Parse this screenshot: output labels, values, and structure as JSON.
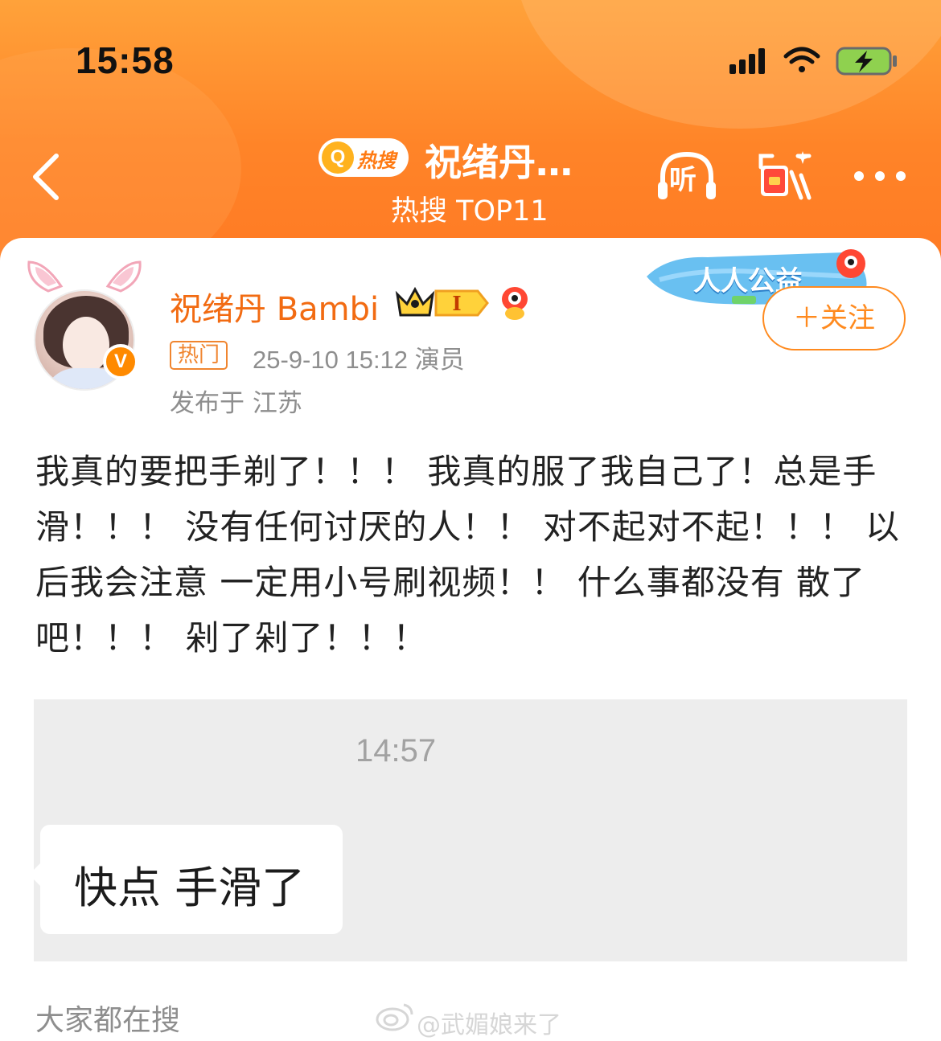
{
  "status_bar": {
    "time": "15:58",
    "icons": [
      "cellular-signal-icon",
      "wifi-icon",
      "battery-charging-icon"
    ]
  },
  "nav": {
    "hot_badge": "热搜",
    "hot_badge_icon": "Q",
    "title": "祝绪丹…",
    "subtitle": "热搜 TOP11",
    "listen_label": "听"
  },
  "post": {
    "user": {
      "name": "祝绪丹 Bambi",
      "level_badge": "I",
      "verified_mark": "V"
    },
    "tag": "热门",
    "meta": "25-9-10 15:12  演员",
    "location": "发布于 江苏",
    "banner_text": "人人公益",
    "follow_label": "＋关注",
    "body": "我真的要把手剃了！！！ 我真的服了我自己了！总是手滑！！！ 没有任何讨厌的人！！ 对不起对不起！！！ 以后我会注意 一定用小号刷视频！！ 什么事都没有 散了吧！！！ 剁了剁了！！！",
    "screenshot": {
      "time": "14:57",
      "message": "快点 手滑了"
    }
  },
  "footer": {
    "section_label": "大家都在搜",
    "watermark": "@武媚娘来了"
  },
  "colors": {
    "header_orange": "#ff8428",
    "brand_orange": "#f26b12",
    "follow_orange": "#ff8a1e",
    "meta_gray": "#8e8e8e"
  }
}
